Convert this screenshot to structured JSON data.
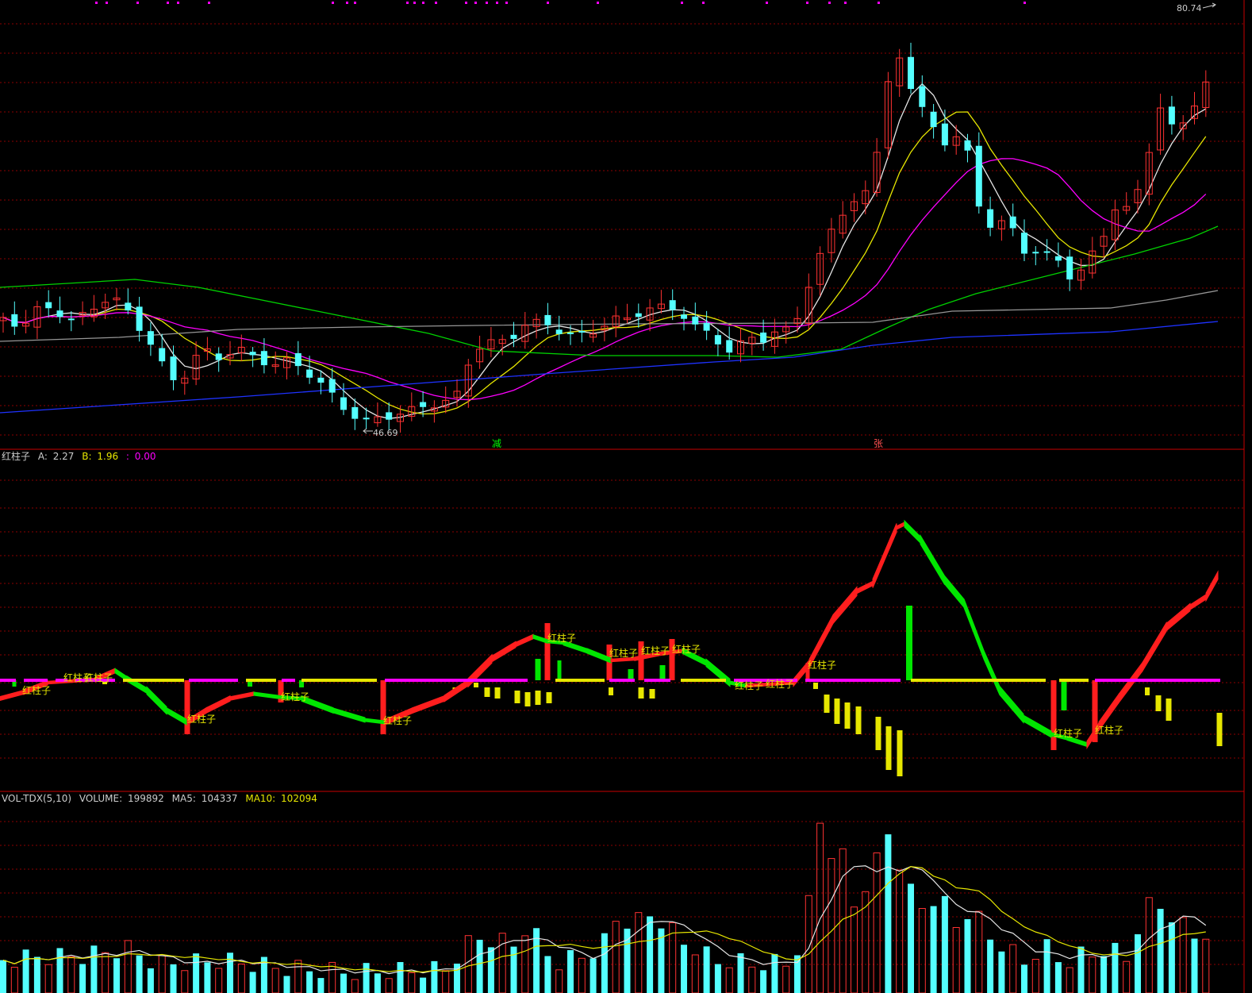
{
  "price_panel": {
    "high_label": "80.74",
    "low_label": "46.69",
    "signal_jian": "减",
    "signal_zhang": "张"
  },
  "indicator_panel": {
    "name": "红柱子",
    "a_label": "A:",
    "a_value": "2.27",
    "b_label": "B:",
    "b_value": "1.96",
    "c_label": ":",
    "c_value": "0.00",
    "marker_text": "红柱子"
  },
  "volume_panel": {
    "name": "VOL-TDX(5,10)",
    "volume_label": "VOLUME:",
    "volume_value": "199892",
    "ma5_label": "MA5:",
    "ma5_value": "104337",
    "ma10_label": "MA10:",
    "ma10_value": "102094"
  },
  "colors": {
    "up": "#ff3232",
    "down": "#54ffff",
    "ma_white": "#e6e6e6",
    "ma_yellow": "#e6e600",
    "ma_magenta": "#ff00ff",
    "ma_green": "#00d200",
    "ma_gray": "#969696",
    "ma_blue": "#1e32ff",
    "grid": "#8c0000"
  },
  "chart_data": [
    {
      "type": "candlestick",
      "ylim": [
        44,
        82
      ],
      "ma_lines": [
        "white",
        "yellow",
        "magenta",
        "green",
        "gray",
        "blue"
      ],
      "extremes": {
        "high": 80.74,
        "low": 46.69
      }
    },
    {
      "type": "bar",
      "name": "红柱子",
      "series": [
        {
          "name": "A",
          "value": 2.27
        },
        {
          "name": "B",
          "value": 1.96
        },
        {
          "value": 0.0
        }
      ]
    },
    {
      "type": "bar",
      "name": "VOL-TDX(5,10)",
      "latest": {
        "volume": 199892,
        "ma5": 104337,
        "ma10": 102094
      }
    }
  ]
}
